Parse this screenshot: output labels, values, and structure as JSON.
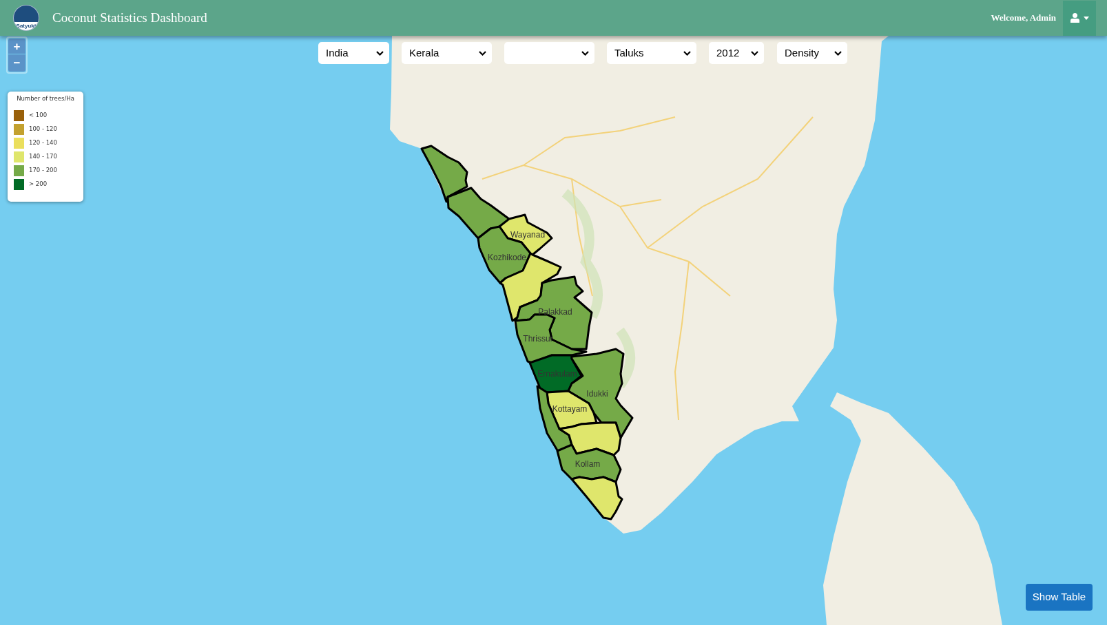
{
  "header": {
    "logo_text": "Satyukt",
    "title": "Coconut Statistics Dashboard",
    "welcome": "Welcome, Admin"
  },
  "map_controls": {
    "zoom_in": "+",
    "zoom_out": "−"
  },
  "filters": [
    {
      "kind": "dropdown",
      "value": "India"
    },
    {
      "kind": "dropdown",
      "value": "Kerala"
    },
    {
      "kind": "dropdown"
    },
    {
      "kind": "dropdown",
      "value": "Taluks"
    },
    {
      "kind": "dropdown",
      "value": "2012"
    },
    {
      "kind": "dropdown",
      "value": "Density"
    }
  ],
  "legend": {
    "title": "Number of trees/Ha",
    "items": [
      {
        "label": "< 100",
        "color": "#99600a"
      },
      {
        "label": "100 - 120",
        "color": "#c3a12f"
      },
      {
        "label": "120 - 140",
        "color": "#ebdf5d"
      },
      {
        "label": "140 - 170",
        "color": "#dfe66c"
      },
      {
        "label": "170 - 200",
        "color": "#75aa48"
      },
      {
        "label": "> 200",
        "color": "#016b26"
      }
    ]
  },
  "districts": [
    {
      "color": "#75aa48"
    },
    {
      "color": "#75aa48"
    },
    {
      "label": "Wayanad",
      "color": "#dfe66c"
    },
    {
      "label": "Kozhikode",
      "color": "#75aa48"
    },
    {
      "color": "#dfe66c"
    },
    {
      "label": "Palakkad",
      "color": "#75aa48"
    },
    {
      "label": "Thrissur",
      "color": "#75aa48"
    },
    {
      "label": "Ernakulam",
      "color": "#016b26"
    },
    {
      "label": "Idukki",
      "color": "#75aa48"
    },
    {
      "label": "Kottayam",
      "color": "#dfe66c"
    },
    {
      "color": "#75aa48"
    },
    {
      "color": "#dfe66c"
    },
    {
      "label": "Kollam",
      "color": "#75aa48"
    },
    {
      "color": "#dfe66c"
    }
  ],
  "show_table_button": "Show Table"
}
